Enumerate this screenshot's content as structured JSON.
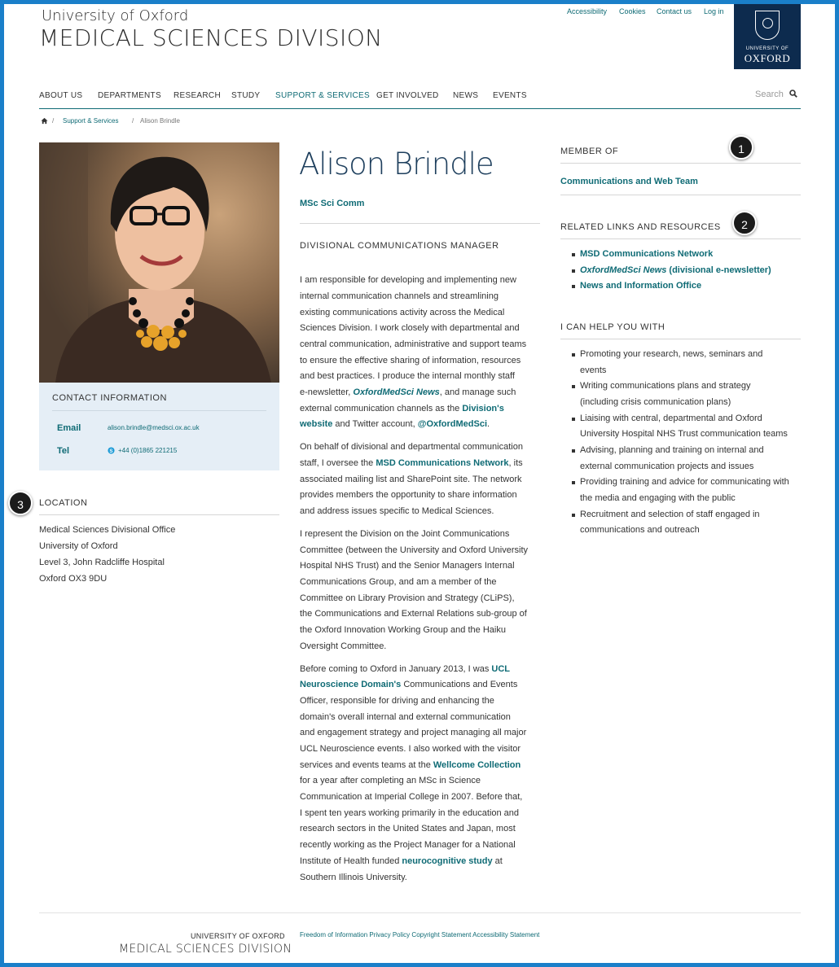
{
  "header": {
    "university": "University of Oxford",
    "division": "MEDICAL SCIENCES DIVISION",
    "utility_links": [
      "Accessibility",
      "Cookies",
      "Contact us",
      "Log in"
    ],
    "logo_university": "UNIVERSITY OF",
    "logo_oxford": "OXFORD"
  },
  "nav": {
    "items": [
      "ABOUT US",
      "DEPARTMENTS",
      "RESEARCH",
      "STUDY",
      "SUPPORT & SERVICES",
      "GET INVOLVED",
      "NEWS",
      "EVENTS"
    ],
    "active": "SUPPORT & SERVICES",
    "search_placeholder": "Search"
  },
  "breadcrumb": [
    "Support & Services",
    "Alison Brindle"
  ],
  "profile": {
    "name": "Alison Brindle",
    "degree": "MSc Sci Comm",
    "job_title": "DIVISIONAL COMMUNICATIONS MANAGER"
  },
  "contact": {
    "title": "CONTACT INFORMATION",
    "email_label": "Email",
    "email": "alison.brindle@medsci.ox.ac.uk",
    "tel_label": "Tel",
    "tel": "+44 (0)1865 221215"
  },
  "location": {
    "title": "LOCATION",
    "lines": [
      "Medical Sciences Divisional Office",
      "University of Oxford",
      "Level 3, John Radcliffe Hospital",
      "Oxford OX3 9DU"
    ]
  },
  "bio": {
    "p1": [
      "I am responsible for developing and implementing new",
      "internal communication channels and streamlining",
      "existing communications activity across the Medical",
      "Sciences Division.  I work closely with departmental and",
      "central communication, administrative and support teams",
      "to ensure the effective sharing of information, resources",
      "and best practices. I produce the internal monthly staff"
    ],
    "p1_l8_a": "e-newsletter, ",
    "p1_l8_link": "OxfordMedSci News",
    "p1_l8_b": ", and manage such",
    "p1_l9_a": "external communication channels as the ",
    "p1_l9_link": "Division's",
    "p1_l10_link": "website",
    "p1_l10_b": " and Twitter account, ",
    "p1_l10_link2": "@OxfordMedSci",
    "p1_l10_c": ".",
    "p2_l1": "On behalf of divisional and departmental communication",
    "p2_l2_a": "staff, I oversee the ",
    "p2_l2_link": "MSD Communications Network",
    "p2_l2_b": ", its",
    "p2": [
      "associated mailing list and SharePoint site. The network",
      "provides members the opportunity to share information",
      "and address issues specific to Medical Sciences."
    ],
    "p3": [
      "I represent the Division on the Joint Communications",
      "Committee (between the University and Oxford University",
      "Hospital NHS Trust) and the Senior Managers Internal",
      "Communications Group, and am a member of the",
      "Committee on Library Provision and Strategy (CLiPS),",
      "the Communications and External Relations sub-group of",
      "the Oxford Innovation Working Group and the Haiku",
      "Oversight Committee."
    ],
    "p4_l1_a": "Before coming to Oxford in January 2013, I was ",
    "p4_l1_link": "UCL",
    "p4_l2_link": "Neuroscience Domain's",
    "p4_l2_b": " Communications and Events",
    "p4_mid": [
      "Officer, responsible for driving and enhancing the",
      "domain's overall internal and external communication",
      "and engagement strategy and project managing all major",
      "UCL Neuroscience events. I also worked with the visitor"
    ],
    "p4_l7_a": "services and events teams at the ",
    "p4_l7_link": "Wellcome Collection",
    "p4_end": [
      "for a year after completing an MSc in Science",
      "Communication at Imperial College in 2007.  Before that,",
      "I spent ten years working primarily in the education and",
      "research sectors in the United States and Japan, most",
      "recently working as the Project Manager for a National"
    ],
    "p4_l13_a": "Institute of Health funded ",
    "p4_l13_link": "neurocognitive study",
    "p4_l13_b": " at",
    "p4_l14": "Southern Illinois University."
  },
  "sidebar": {
    "member_title": "MEMBER OF",
    "member_link": "Communications and Web Team",
    "related_title": "RELATED LINKS AND RESOURCES",
    "related_1": "MSD Communications Network",
    "related_2_italic": "OxfordMedSci News",
    "related_2_rest": " (divisional e-newsletter)",
    "related_3": "News and Information Office",
    "help_title": "I CAN HELP YOU WITH",
    "help_lines": [
      "Promoting your research, news, seminars and",
      "events",
      "Writing communications plans and strategy",
      "(including crisis communication plans)",
      "Liaising with central, departmental and Oxford",
      "University Hospital NHS Trust communication teams",
      "Advising, planning and training on internal and",
      "external communication projects and issues",
      "Providing training and advice for communicating with",
      "the media and engaging with the public",
      "Recruitment and selection of staff engaged in",
      "communications and outreach"
    ]
  },
  "badges": [
    "1",
    "2",
    "3"
  ],
  "footer": {
    "university": "UNIVERSITY OF OXFORD",
    "division": "MEDICAL SCIENCES DIVISION",
    "links": [
      "Freedom of Information",
      "Privacy Policy",
      "Copyright Statement",
      "Accessibility Statement"
    ]
  },
  "colors": {
    "accent": "#0f6b75",
    "frame": "#1a7fc9",
    "contact_bg": "#e5eef6",
    "logo_bg": "#0d2b4e"
  }
}
